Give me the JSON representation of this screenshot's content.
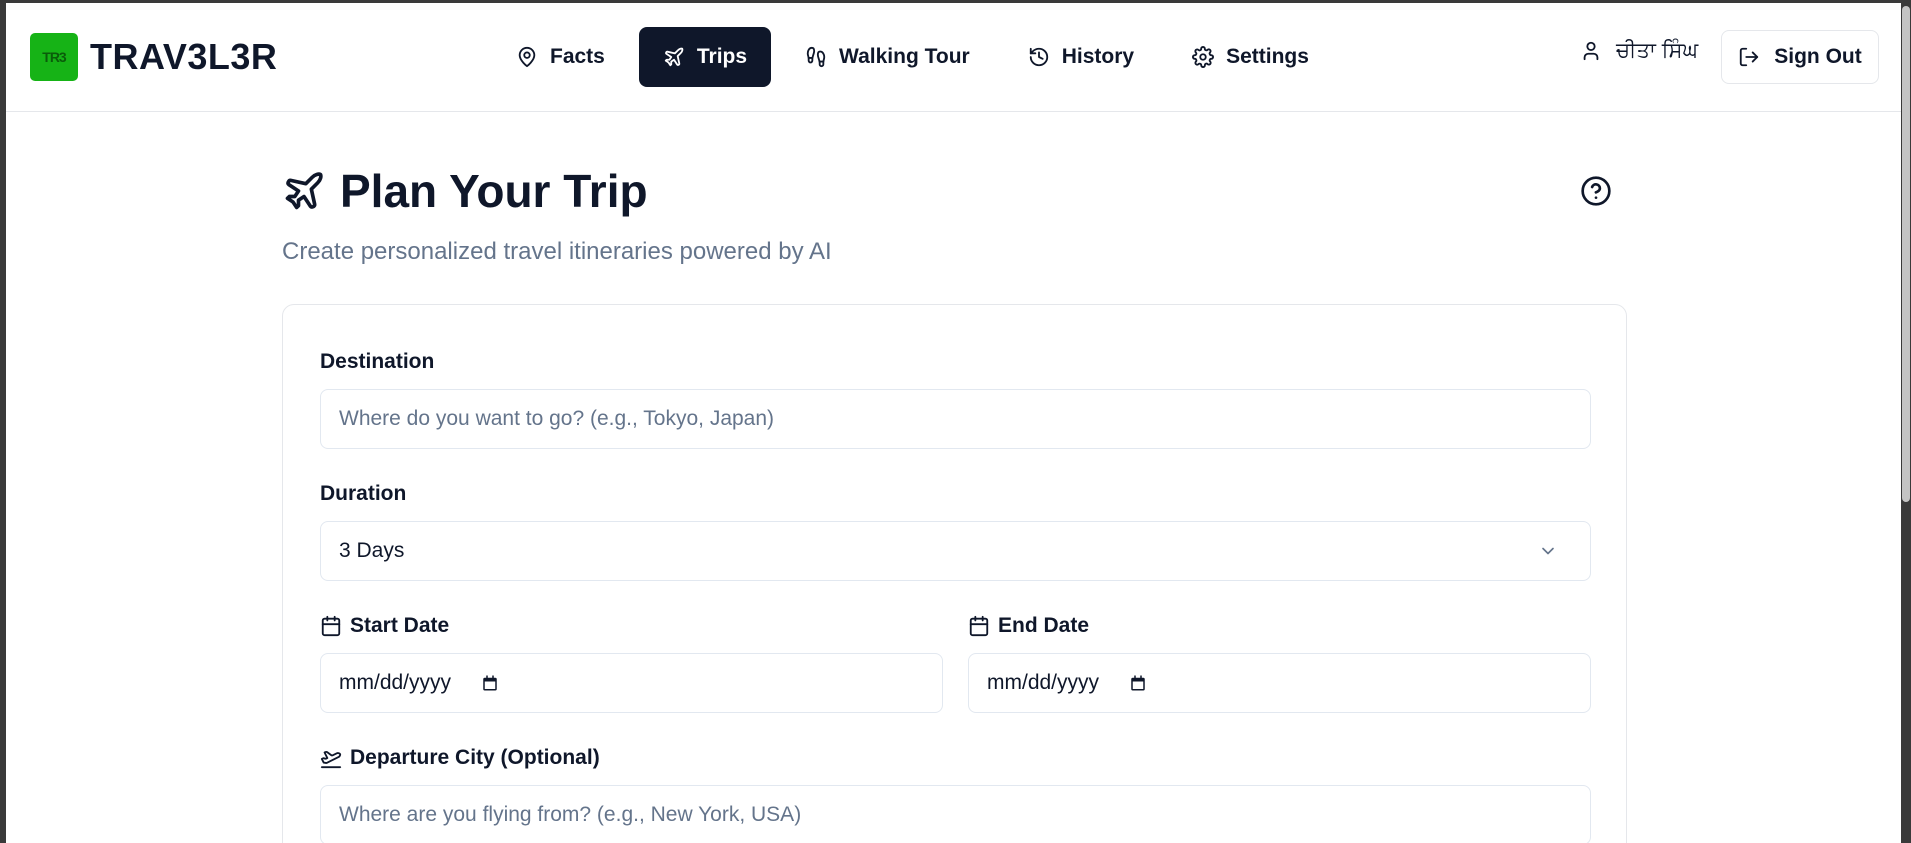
{
  "brand": {
    "logo_text": "TR3",
    "name": "TRAV3L3R",
    "logo_color": "#16b316"
  },
  "nav": {
    "items": [
      {
        "label": "Facts",
        "icon": "map-pin-icon",
        "active": false
      },
      {
        "label": "Trips",
        "icon": "plane-icon",
        "active": true
      },
      {
        "label": "Walking Tour",
        "icon": "footprints-icon",
        "active": false
      },
      {
        "label": "History",
        "icon": "history-icon",
        "active": false
      },
      {
        "label": "Settings",
        "icon": "gear-icon",
        "active": false
      }
    ]
  },
  "user": {
    "name": "ਚੀਤਾ ਸਿੰਘ",
    "icon": "user-icon"
  },
  "signout": {
    "label": "Sign Out",
    "icon": "logout-icon"
  },
  "page": {
    "title": "Plan Your Trip",
    "subtitle": "Create personalized travel itineraries powered by AI",
    "help_icon": "help-circle-icon"
  },
  "form": {
    "destination": {
      "label": "Destination",
      "value": "",
      "placeholder": "Where do you want to go? (e.g., Tokyo, Japan)"
    },
    "duration": {
      "label": "Duration",
      "selected": "3 Days"
    },
    "start_date": {
      "label": "Start Date",
      "placeholder": "mm/dd/yyyy"
    },
    "end_date": {
      "label": "End Date",
      "placeholder": "mm/dd/yyyy"
    },
    "departure": {
      "label": "Departure City (Optional)",
      "value": "",
      "placeholder": "Where are you flying from? (e.g., New York, USA)"
    }
  },
  "colors": {
    "primary": "#0f172a",
    "muted": "#64748b",
    "border": "#e5e7eb"
  }
}
